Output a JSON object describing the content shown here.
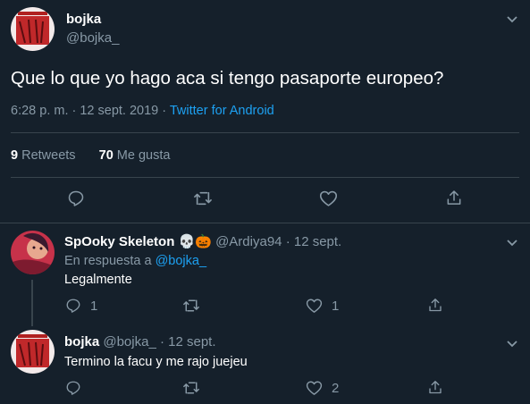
{
  "main_tweet": {
    "name": "bojka",
    "handle": "@bojka_",
    "text": "Que lo que yo hago aca si tengo pasaporte europeo?",
    "time": "6:28 p. m. · 12 sept. 2019 · ",
    "source": "Twitter for Android",
    "retweets_count": "9",
    "retweets_label": "Retweets",
    "likes_count": "70",
    "likes_label": "Me gusta"
  },
  "reply1": {
    "name": "SpOoky Skeleton",
    "emoji": "💀🎃",
    "handle": "@Ardiya94",
    "date": "· 12 sept.",
    "in_reply_prefix": "En respuesta a ",
    "in_reply_handle": "@bojka_",
    "text": "Legalmente",
    "reply_count": "1",
    "retweet_count": "",
    "like_count": "1"
  },
  "reply2": {
    "name": "bojka",
    "handle": "@bojka_",
    "date": "· 12 sept.",
    "text": "Termino la facu y me rajo juejeu",
    "reply_count": "",
    "retweet_count": "",
    "like_count": "2"
  },
  "icons": [
    "chevron-down-icon",
    "reply-icon",
    "retweet-icon",
    "like-icon",
    "share-icon"
  ],
  "colors": {
    "background": "#15202b",
    "muted": "#8899a6",
    "link": "#1da1f2",
    "divider": "#38444d"
  }
}
